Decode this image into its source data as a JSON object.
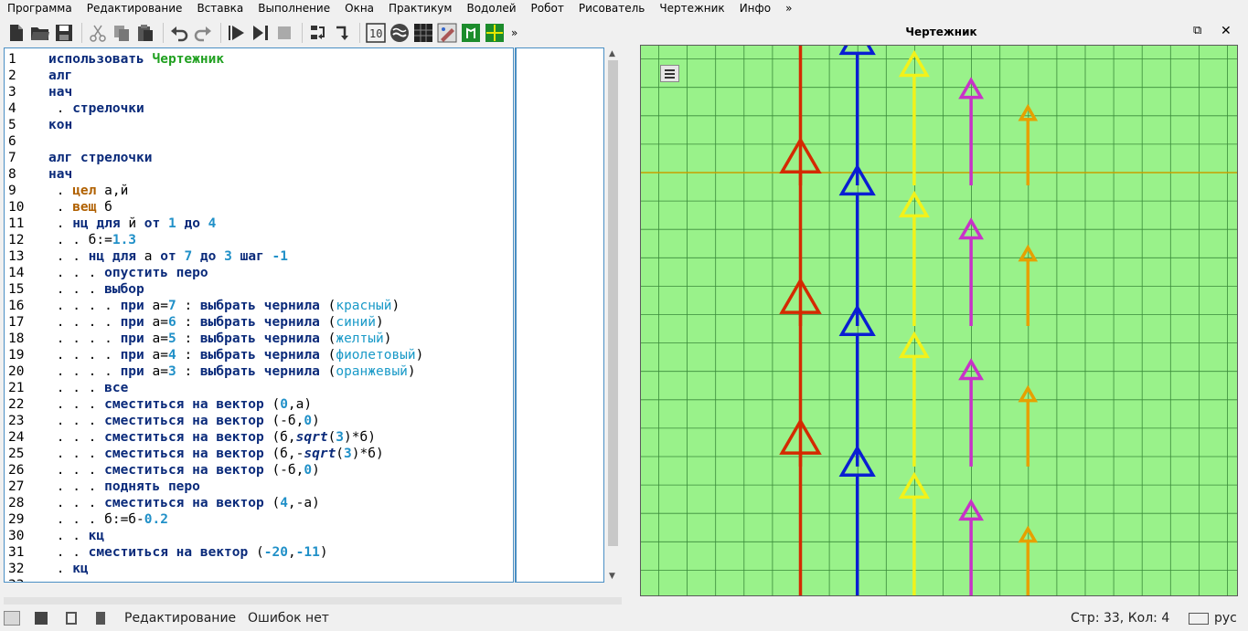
{
  "menu": [
    "Программа",
    "Редактирование",
    "Вставка",
    "Выполнение",
    "Окна",
    "Практикум",
    "Водолей",
    "Робот",
    "Рисователь",
    "Чертежник",
    "Инфо",
    "»"
  ],
  "toolbar": {
    "icons": [
      "new-file",
      "open-folder",
      "save",
      "cut",
      "copy",
      "paste",
      "undo",
      "redo",
      "run",
      "run-step",
      "stop",
      "step-into",
      "step-out",
      "counter-10",
      "vodoley",
      "robot-grid",
      "painter",
      "chertezhnik-app",
      "grid-app"
    ],
    "more_label": "»"
  },
  "draw_panel": {
    "title": "Чертежник",
    "restore_label": "⧉",
    "close_label": "✕",
    "menu_icon": "hamburger-icon",
    "background_color": "#99f28a",
    "grid_color": "#3a8a3a",
    "axis_color": "#c8a000",
    "arrow_columns": [
      {
        "color": "#d42a00",
        "ink": "красный",
        "length": 7
      },
      {
        "color": "#0a1ed2",
        "ink": "синий",
        "length": 6
      },
      {
        "color": "#f2f21a",
        "ink": "желтый",
        "length": 5
      },
      {
        "color": "#c832c8",
        "ink": "фиолетовый",
        "length": 4
      },
      {
        "color": "#e6a000",
        "ink": "оранжевый",
        "length": 3
      }
    ],
    "arrow_rows": 4
  },
  "editor": {
    "lines": [
      {
        "n": "1",
        "segs": [
          [
            "k",
            "использовать "
          ],
          [
            "g",
            "Чертежник"
          ]
        ]
      },
      {
        "n": "2",
        "segs": [
          [
            "k",
            "алг"
          ]
        ]
      },
      {
        "n": "3",
        "segs": [
          [
            "k",
            "нач"
          ]
        ]
      },
      {
        "n": "4",
        "segs": [
          [
            "v",
            " . "
          ],
          [
            "k",
            "стрелочки"
          ]
        ]
      },
      {
        "n": "5",
        "segs": [
          [
            "k",
            "кон"
          ]
        ]
      },
      {
        "n": "6",
        "segs": []
      },
      {
        "n": "7",
        "segs": [
          [
            "k",
            "алг стрелочки"
          ]
        ]
      },
      {
        "n": "8",
        "segs": [
          [
            "k",
            "нач"
          ]
        ]
      },
      {
        "n": "9",
        "segs": [
          [
            "v",
            " . "
          ],
          [
            "t",
            "цел"
          ],
          [
            "v",
            " а,й"
          ]
        ]
      },
      {
        "n": "10",
        "segs": [
          [
            "v",
            " . "
          ],
          [
            "t",
            "вещ"
          ],
          [
            "v",
            " б"
          ]
        ]
      },
      {
        "n": "11",
        "segs": [
          [
            "v",
            " . "
          ],
          [
            "k",
            "нц для"
          ],
          [
            "v",
            " й "
          ],
          [
            "k",
            "от"
          ],
          [
            "v",
            " "
          ],
          [
            "n",
            "1"
          ],
          [
            "v",
            " "
          ],
          [
            "k",
            "до"
          ],
          [
            "v",
            " "
          ],
          [
            "n",
            "4"
          ]
        ]
      },
      {
        "n": "12",
        "segs": [
          [
            "v",
            " . . б:="
          ],
          [
            "n",
            "1.3"
          ]
        ]
      },
      {
        "n": "13",
        "segs": [
          [
            "v",
            " . . "
          ],
          [
            "k",
            "нц для"
          ],
          [
            "v",
            " а "
          ],
          [
            "k",
            "от"
          ],
          [
            "v",
            " "
          ],
          [
            "n",
            "7"
          ],
          [
            "v",
            " "
          ],
          [
            "k",
            "до"
          ],
          [
            "v",
            " "
          ],
          [
            "n",
            "3"
          ],
          [
            "v",
            " "
          ],
          [
            "k",
            "шаг"
          ],
          [
            "v",
            " "
          ],
          [
            "n",
            "-1"
          ]
        ]
      },
      {
        "n": "14",
        "segs": [
          [
            "v",
            " . . . "
          ],
          [
            "k",
            "опустить перо"
          ]
        ]
      },
      {
        "n": "15",
        "segs": [
          [
            "v",
            " . . . "
          ],
          [
            "k",
            "выбор"
          ]
        ]
      },
      {
        "n": "16",
        "segs": [
          [
            "v",
            " . . . . "
          ],
          [
            "k",
            "при"
          ],
          [
            "v",
            " а="
          ],
          [
            "n",
            "7"
          ],
          [
            "v",
            " : "
          ],
          [
            "k",
            "выбрать чернила"
          ],
          [
            "v",
            " ("
          ],
          [
            "s",
            "красный"
          ],
          [
            "v",
            ")"
          ]
        ]
      },
      {
        "n": "17",
        "segs": [
          [
            "v",
            " . . . . "
          ],
          [
            "k",
            "при"
          ],
          [
            "v",
            " а="
          ],
          [
            "n",
            "6"
          ],
          [
            "v",
            " : "
          ],
          [
            "k",
            "выбрать чернила"
          ],
          [
            "v",
            " ("
          ],
          [
            "s",
            "синий"
          ],
          [
            "v",
            ")"
          ]
        ]
      },
      {
        "n": "18",
        "segs": [
          [
            "v",
            " . . . . "
          ],
          [
            "k",
            "при"
          ],
          [
            "v",
            " а="
          ],
          [
            "n",
            "5"
          ],
          [
            "v",
            " : "
          ],
          [
            "k",
            "выбрать чернила"
          ],
          [
            "v",
            " ("
          ],
          [
            "s",
            "желтый"
          ],
          [
            "v",
            ")"
          ]
        ]
      },
      {
        "n": "19",
        "segs": [
          [
            "v",
            " . . . . "
          ],
          [
            "k",
            "при"
          ],
          [
            "v",
            " а="
          ],
          [
            "n",
            "4"
          ],
          [
            "v",
            " : "
          ],
          [
            "k",
            "выбрать чернила"
          ],
          [
            "v",
            " ("
          ],
          [
            "s",
            "фиолетовый"
          ],
          [
            "v",
            ")"
          ]
        ]
      },
      {
        "n": "20",
        "segs": [
          [
            "v",
            " . . . . "
          ],
          [
            "k",
            "при"
          ],
          [
            "v",
            " а="
          ],
          [
            "n",
            "3"
          ],
          [
            "v",
            " : "
          ],
          [
            "k",
            "выбрать чернила"
          ],
          [
            "v",
            " ("
          ],
          [
            "s",
            "оранжевый"
          ],
          [
            "v",
            ")"
          ]
        ]
      },
      {
        "n": "21",
        "segs": [
          [
            "v",
            " . . . "
          ],
          [
            "k",
            "все"
          ]
        ]
      },
      {
        "n": "22",
        "segs": [
          [
            "v",
            " . . . "
          ],
          [
            "k",
            "сместиться на вектор"
          ],
          [
            "v",
            " ("
          ],
          [
            "n",
            "0"
          ],
          [
            "v",
            ",а)"
          ]
        ]
      },
      {
        "n": "23",
        "segs": [
          [
            "v",
            " . . . "
          ],
          [
            "k",
            "сместиться на вектор"
          ],
          [
            "v",
            " (-б,"
          ],
          [
            "n",
            "0"
          ],
          [
            "v",
            ")"
          ]
        ]
      },
      {
        "n": "24",
        "segs": [
          [
            "v",
            " . . . "
          ],
          [
            "k",
            "сместиться на вектор"
          ],
          [
            "v",
            " (б,"
          ],
          [
            "i",
            "sqrt"
          ],
          [
            "v",
            "("
          ],
          [
            "n",
            "3"
          ],
          [
            "v",
            ")*б)"
          ]
        ]
      },
      {
        "n": "25",
        "segs": [
          [
            "v",
            " . . . "
          ],
          [
            "k",
            "сместиться на вектор"
          ],
          [
            "v",
            " (б,-"
          ],
          [
            "i",
            "sqrt"
          ],
          [
            "v",
            "("
          ],
          [
            "n",
            "3"
          ],
          [
            "v",
            ")*б)"
          ]
        ]
      },
      {
        "n": "26",
        "segs": [
          [
            "v",
            " . . . "
          ],
          [
            "k",
            "сместиться на вектор"
          ],
          [
            "v",
            " (-б,"
          ],
          [
            "n",
            "0"
          ],
          [
            "v",
            ")"
          ]
        ]
      },
      {
        "n": "27",
        "segs": [
          [
            "v",
            " . . . "
          ],
          [
            "k",
            "поднять перо"
          ]
        ]
      },
      {
        "n": "28",
        "segs": [
          [
            "v",
            " . . . "
          ],
          [
            "k",
            "сместиться на вектор"
          ],
          [
            "v",
            " ("
          ],
          [
            "n",
            "4"
          ],
          [
            "v",
            ",-а)"
          ]
        ]
      },
      {
        "n": "29",
        "segs": [
          [
            "v",
            " . . . б:=б-"
          ],
          [
            "n",
            "0.2"
          ]
        ]
      },
      {
        "n": "30",
        "segs": [
          [
            "v",
            " . . "
          ],
          [
            "k",
            "кц"
          ]
        ]
      },
      {
        "n": "31",
        "segs": [
          [
            "v",
            " . . "
          ],
          [
            "k",
            "сместиться на вектор"
          ],
          [
            "v",
            " ("
          ],
          [
            "n",
            "-20"
          ],
          [
            "v",
            ","
          ],
          [
            "n",
            "-11"
          ],
          [
            "v",
            ")"
          ]
        ]
      },
      {
        "n": "32",
        "segs": [
          [
            "v",
            " . "
          ],
          [
            "k",
            "кц"
          ]
        ]
      },
      {
        "n": "33",
        "segs": [
          [
            "k",
            "кон"
          ]
        ]
      }
    ]
  },
  "statusbar": {
    "mode": "Редактирование",
    "errors": "Ошибок нет",
    "position": "Стр: 33, Кол: 4",
    "language": "рус"
  }
}
